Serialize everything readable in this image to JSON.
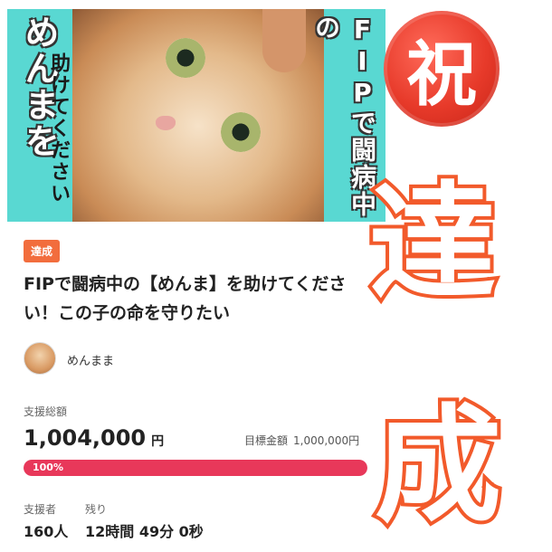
{
  "hero": {
    "title_vertical": "めんまを",
    "subtitle_vertical": "助けてください",
    "right_vertical": "FIPで闘病中の"
  },
  "overlay": {
    "iwai": "祝",
    "tatsu": "達",
    "sei": "成",
    "accent": "#f25a2b"
  },
  "project": {
    "badge": "達成",
    "title": "FIPで闘病中の【めんま】を助けてください！この子の命を守りたい",
    "owner": "めんまま"
  },
  "funding": {
    "total_label": "支援総額",
    "total_value": "1,004,000",
    "currency": "円",
    "goal_label": "目標金額",
    "goal_value": "1,000,000円",
    "progress_text": "100%",
    "progress_fraction": 1.0,
    "bar_color": "#e8385a"
  },
  "stats": {
    "supporters_label": "支援者",
    "supporters_value": "160人",
    "remaining_label": "残り",
    "remaining_value": "12時間 49分 0秒"
  }
}
